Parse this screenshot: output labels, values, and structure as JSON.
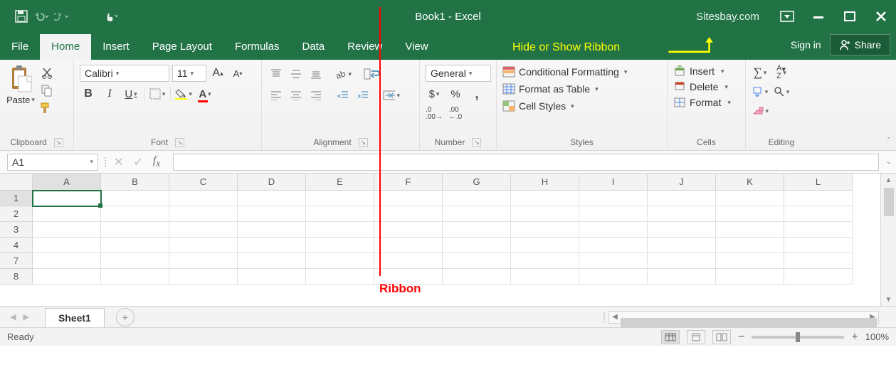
{
  "title": "Book1 - Excel",
  "site_watermark": "Sitesbay.com",
  "annotations": {
    "hide_show": "Hide or Show Ribbon",
    "ribbon_label": "Ribbon"
  },
  "tabs": {
    "file": "File",
    "home": "Home",
    "insert": "Insert",
    "page_layout": "Page Layout",
    "formulas": "Formulas",
    "data": "Data",
    "review": "Review",
    "view": "View",
    "active": "Home"
  },
  "signin": "Sign in",
  "share": "Share",
  "ribbon": {
    "clipboard": {
      "paste": "Paste",
      "label": "Clipboard"
    },
    "font": {
      "name": "Calibri",
      "size": "11",
      "label": "Font"
    },
    "alignment": {
      "label": "Alignment"
    },
    "number": {
      "format": "General",
      "label": "Number"
    },
    "styles": {
      "cond_fmt": "Conditional Formatting",
      "as_table": "Format as Table",
      "cell_styles": "Cell Styles",
      "label": "Styles"
    },
    "cells": {
      "insert": "Insert",
      "delete": "Delete",
      "format": "Format",
      "label": "Cells"
    },
    "editing": {
      "label": "Editing"
    }
  },
  "name_box": "A1",
  "columns": [
    "A",
    "B",
    "C",
    "D",
    "E",
    "F",
    "G",
    "H",
    "I",
    "J",
    "K",
    "L"
  ],
  "rows": [
    "1",
    "2",
    "3",
    "4",
    "7",
    "8"
  ],
  "active_cell": {
    "row": 0,
    "col": 0
  },
  "sheet_tab": "Sheet1",
  "status": {
    "ready": "Ready",
    "zoom": "100%"
  }
}
